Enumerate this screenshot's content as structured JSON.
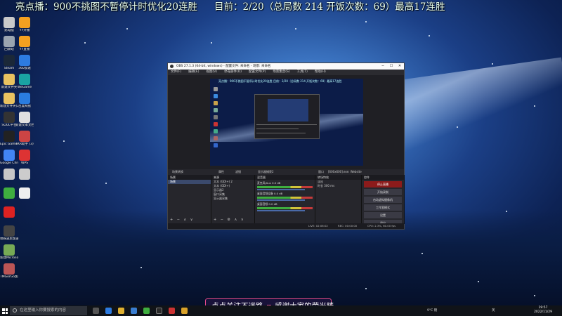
{
  "banner": {
    "part1": "亮点播：900不挑图不暂停计时优化20连胜",
    "part2": "目前：2/20（总局数 214 开饭次数：69）最高17连胜"
  },
  "desktop_icons": {
    "col1": [
      "此电脑",
      "回收站",
      "Steam",
      "新建文件夹",
      "新建文件夹(2)",
      "SOUL平台",
      "Epic Games Launcher",
      "Google Chrome",
      "",
      "",
      "",
      "地铁逃生加速器",
      "新建Microsoft...",
      "TMGorGo加速"
    ],
    "col2": [
      "YY开播",
      "YY直播",
      "360加速",
      "WeGame",
      "百度网盘",
      "新建文本文档",
      "TKR助手 (3)",
      "WPS",
      "",
      ""
    ]
  },
  "obs": {
    "title": "OBS 27.1.3 (64-bit, windows) - 配置文件: 未命名 - 场景: 未命名",
    "menu": [
      "文件(F)",
      "编辑(E)",
      "视图(V)",
      "停靠部件(D)",
      "配置文件(P)",
      "场景集合(S)",
      "工具(T)",
      "帮助(H)"
    ],
    "preview_banner": "亮点播：900不挑图不暂停计时优化20连胜   目前：2/20（总局数 214 开饭次数：69）最高17连胜",
    "bar": {
      "scene_label": "场景转换",
      "properties": "属性",
      "filters": "滤镜",
      "source_label": "显示器捕获2",
      "window_label": "窗口",
      "window_value": "[600x600].exe: Website"
    },
    "docks": {
      "scenes": {
        "header": "场景",
        "items": [
          "场景"
        ]
      },
      "sources": {
        "header": "来源",
        "items": [
          "文本 (GDI+) 2",
          "文本 (GDI+)",
          "显示器2",
          "窗口采集",
          "显示器采集"
        ]
      },
      "mixer": {
        "header": "混音器",
        "channels": [
          {
            "name": "麦克风/Aux",
            "db": "0.0 dB"
          },
          {
            "name": "桌面音频设备",
            "db": "0.0 dB"
          },
          {
            "name": "桌面音频",
            "db": "0.0 dB"
          }
        ]
      },
      "transitions": {
        "header": "转场特效",
        "type": "淡出",
        "duration_label": "时长",
        "duration": "300 ms"
      },
      "controls": {
        "header": "控件",
        "buttons": [
          "停止直播",
          "开始录制",
          "启动虚拟摄像机",
          "工作室模式",
          "设置",
          "退出"
        ]
      }
    },
    "status": {
      "live": "LIVE: 02:06:02",
      "rec": "REC: 00:00:00",
      "cpu": "CPU: 2.3%, 60.00 fps"
    }
  },
  "follow": {
    "left": "点点关注不迷路",
    "right": "感谢大家的荧光棒"
  },
  "taskbar": {
    "search_placeholder": "在这里输入你要搜索的内容",
    "weather": "9°C 阴",
    "lang": "英",
    "time": "19:57",
    "date": "2022/11/29"
  },
  "colors": {
    "accent_live": "#8c1b1b",
    "follow_border": "#e84a8a"
  }
}
